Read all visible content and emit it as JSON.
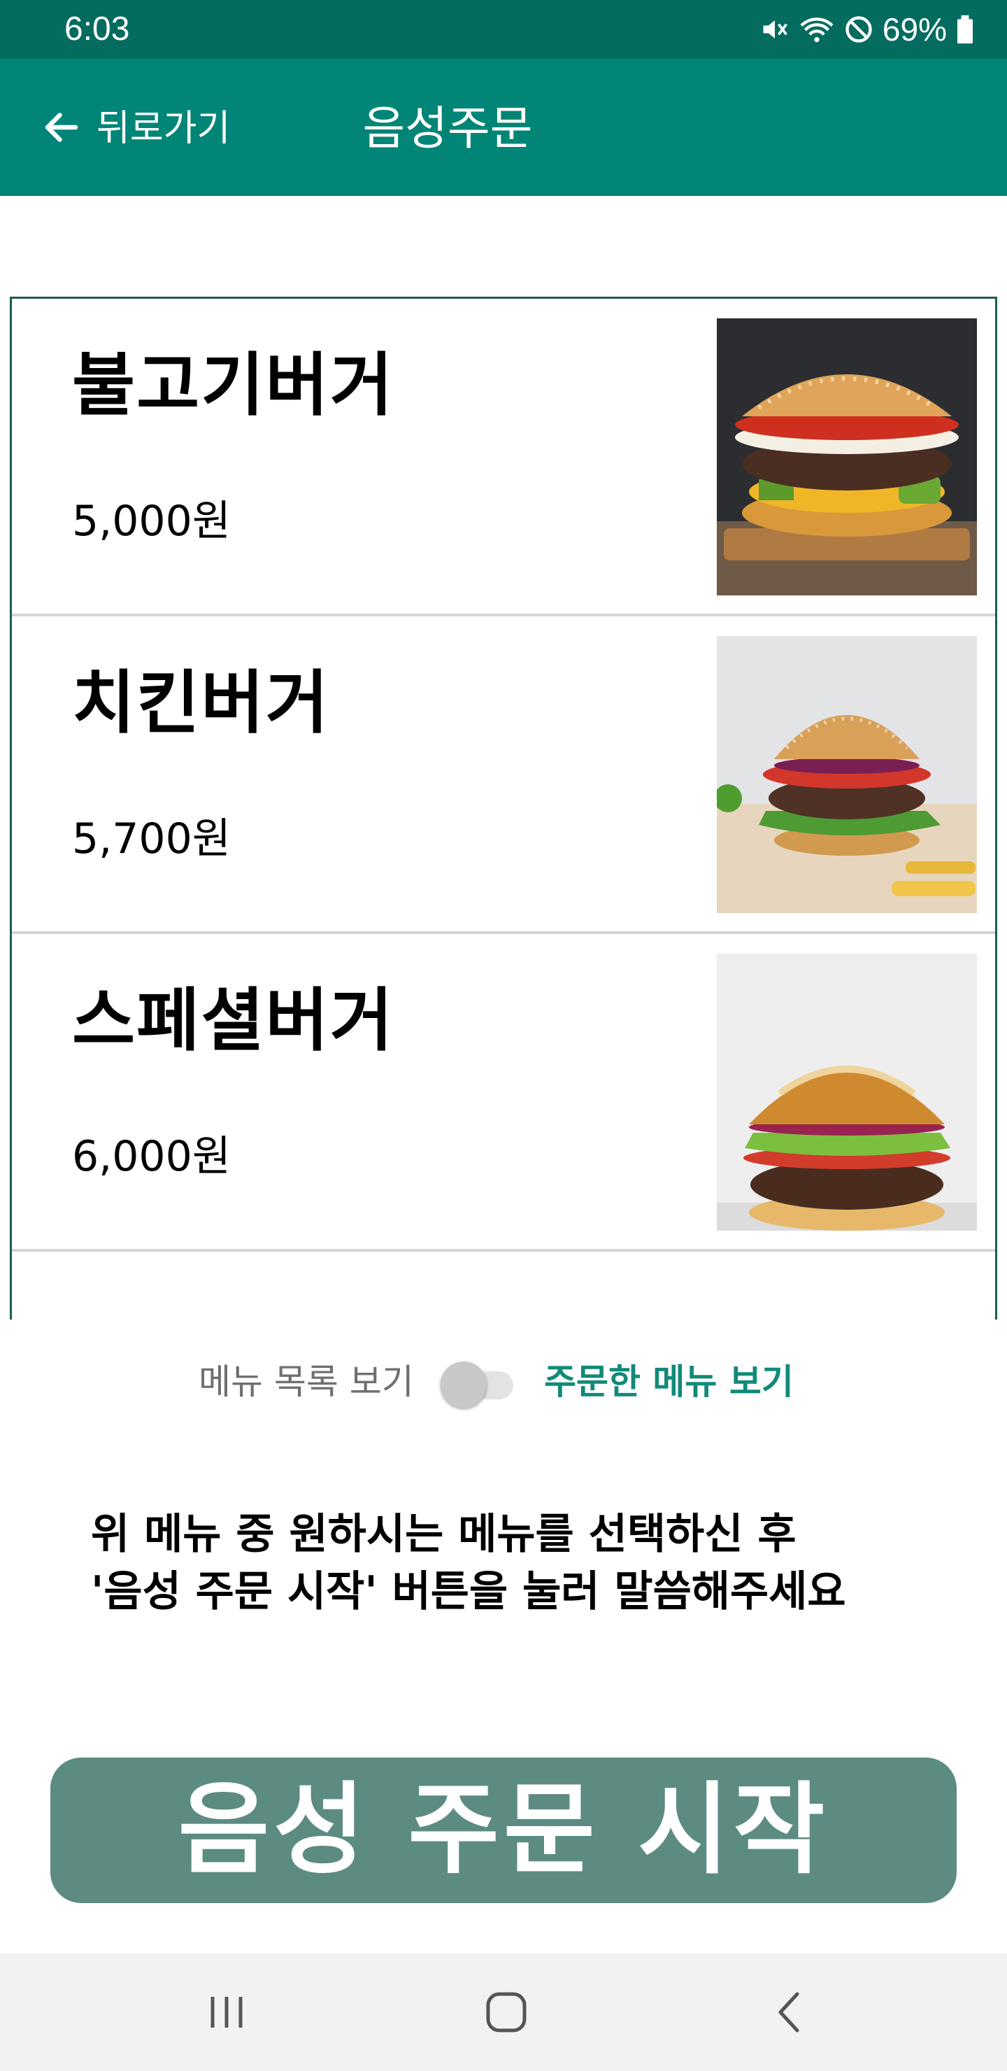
{
  "status_bar": {
    "time": "6:03",
    "battery_percent": "69%",
    "icons": [
      "mute-icon",
      "wifi-icon",
      "do-not-disturb-icon",
      "battery-icon"
    ]
  },
  "app_bar": {
    "back_label": "뒤로가기",
    "title": "음성주문",
    "background_color": "#018577"
  },
  "menu_items": [
    {
      "name": "불고기버거",
      "price": "5,000원",
      "image": "burger-image"
    },
    {
      "name": "치킨버거",
      "price": "5,700원",
      "image": "burger-image"
    },
    {
      "name": "스페셜버거",
      "price": "6,000원",
      "image": "burger-image"
    }
  ],
  "toggle": {
    "left_label": "메뉴 목록 보기",
    "right_label": "주문한 메뉴 보기",
    "state": "off"
  },
  "instruction": {
    "line1": "위 메뉴 중 원하시는 메뉴를 선택하신 후",
    "line2": "'음성 주문 시작' 버튼을 눌러 말씀해주세요"
  },
  "start_button": {
    "label": "음성 주문 시작",
    "color": "#5c8b81"
  },
  "nav_bar": {
    "icons": [
      "recent-apps-icon",
      "home-icon",
      "back-nav-icon"
    ]
  }
}
